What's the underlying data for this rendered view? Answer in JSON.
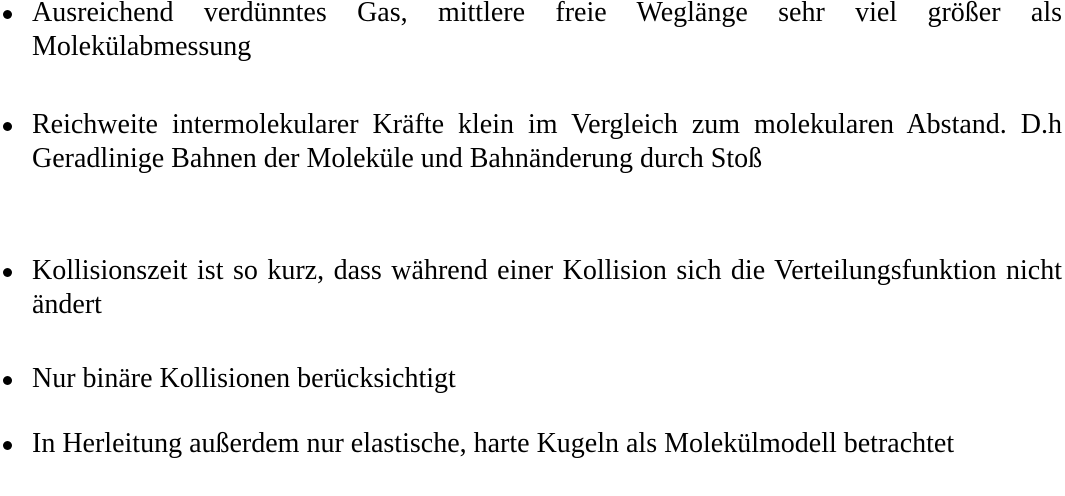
{
  "bullets": [
    {
      "text": "Ausreichend verdünntes Gas, mittlere freie Weglänge sehr viel größer als Molekülabmessung"
    },
    {
      "text": "Reichweite intermolekularer Kräfte klein im Vergleich zum molekularen Abstand. D.h Geradlinige Bahnen der Moleküle und Bahnänderung durch Stoß"
    },
    {
      "text": "Kollisionszeit ist so kurz, dass während einer Kollision sich die Verteilungs­funktion nicht ändert"
    },
    {
      "text": "Nur binäre Kollisionen berücksichtigt"
    },
    {
      "text": "In Herleitung außerdem nur elastische, harte Kugeln als Molekülmodell betrachtet"
    }
  ]
}
